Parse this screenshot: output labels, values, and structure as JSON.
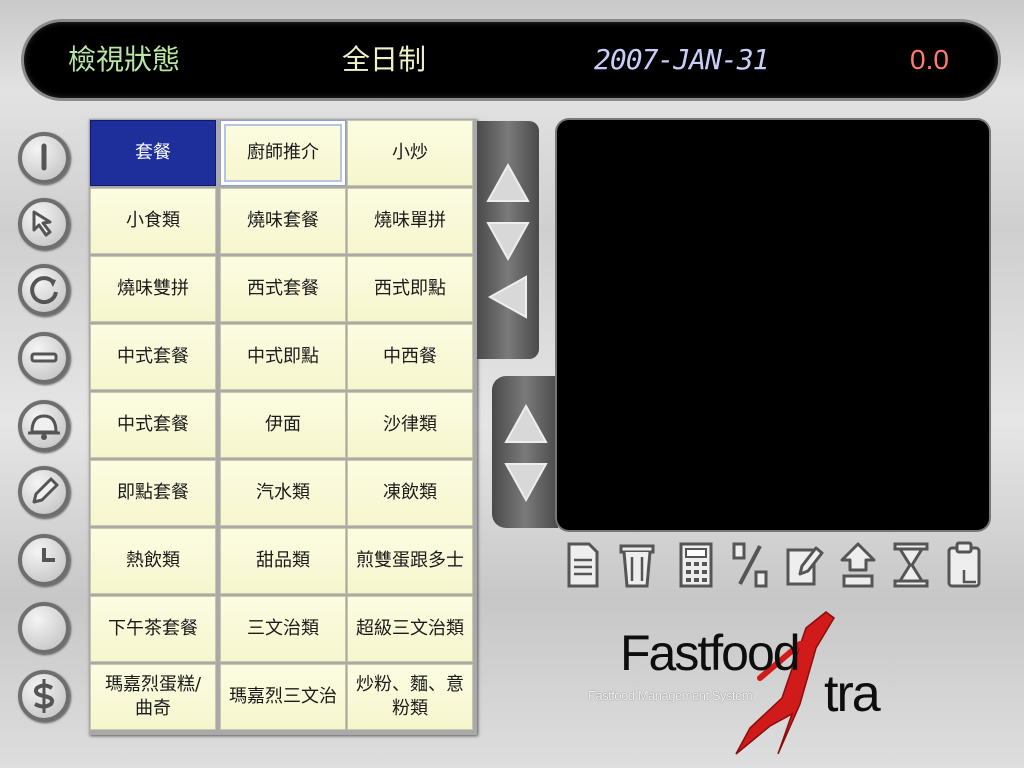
{
  "status_bar": {
    "mode": "檢視狀態",
    "shift": "全日制",
    "date": "2007-JAN-31",
    "amount": "0.0"
  },
  "side_icons": [
    "power-icon",
    "cursor-arrow-icon",
    "refresh-icon",
    "minus-icon",
    "bell-icon",
    "pencil-icon",
    "clock-icon",
    "circle-icon",
    "dollar-icon"
  ],
  "menu": {
    "categories": [
      "套餐",
      "廚師推介",
      "小炒",
      "小食類",
      "燒味套餐",
      "燒味單拼",
      "燒味雙拼",
      "西式套餐",
      "西式即點",
      "中式套餐",
      "中式即點",
      "中西餐",
      "中式套餐",
      "伊面",
      "沙律類",
      "即點套餐",
      "汽水類",
      "凍飲類",
      "熱飲類",
      "甜品類",
      "煎雙蛋跟多士",
      "下午茶套餐",
      "三文治類",
      "超級三文治類",
      "瑪嘉烈蛋糕/曲奇",
      "瑪嘉烈三文治",
      "炒粉、麵、意粉類"
    ],
    "active_index": 0,
    "selected_index": 1
  },
  "toolbar": [
    "document-icon",
    "trash-icon",
    "calculator-icon",
    "percent-icon",
    "edit-icon",
    "home-up-icon",
    "hourglass-icon",
    "clipboard-icon"
  ],
  "logo": {
    "main": "Fastfood",
    "accent": "tra",
    "subtitle": "Fastfood Management System"
  },
  "colors": {
    "active_cell": "#1e2f9c",
    "cell_bg": "#f8f8d2",
    "amount": "#ff7b72",
    "logo_red": "#d11a1a"
  }
}
